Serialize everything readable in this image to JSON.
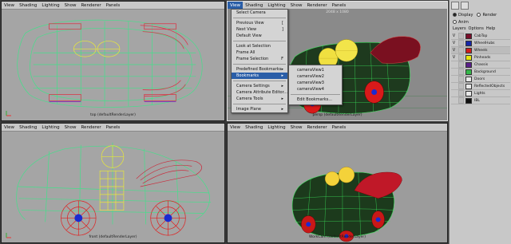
{
  "top_left": {
    "menu": [
      "View",
      "Shading",
      "Lighting",
      "Show",
      "Renderer",
      "Panels"
    ],
    "camera_label": "top (defaultRenderLayer)"
  },
  "top_right": {
    "menu": [
      "View",
      "Shading",
      "Lighting",
      "Show",
      "Renderer",
      "Panels"
    ],
    "resolution_label": "2048 x 1080",
    "camera_label": "persp (defaultRenderLayer)"
  },
  "bottom_left": {
    "menu": [
      "View",
      "Shading",
      "Lighting",
      "Show",
      "Renderer",
      "Panels"
    ],
    "camera_label": "front (defaultRenderLayer)"
  },
  "bottom_right": {
    "menu": [
      "View",
      "Shading",
      "Lighting",
      "Show",
      "Renderer",
      "Panels"
    ],
    "camera_label": "WorkCam (defaultRenderLayer)"
  },
  "view_menu": {
    "items": [
      {
        "label": "Select Camera",
        "key": ""
      },
      {
        "label": "Previous View",
        "key": "["
      },
      {
        "label": "Next View",
        "key": "]"
      },
      {
        "label": "Default View",
        "key": ""
      },
      {
        "label": "Look at Selection",
        "key": ""
      },
      {
        "label": "Frame All",
        "key": ""
      },
      {
        "label": "Frame Selection",
        "key": "F"
      },
      {
        "label": "Predefined Bookmarks",
        "key": "▸"
      },
      {
        "label": "Bookmarks",
        "key": "▸"
      },
      {
        "label": "Camera Settings",
        "key": "▸"
      },
      {
        "label": "Camera Attribute Editor...",
        "key": ""
      },
      {
        "label": "Camera Tools",
        "key": "▸"
      },
      {
        "label": "Image Plane",
        "key": "▸"
      }
    ]
  },
  "bookmarks_menu": {
    "items": [
      "cameraView1",
      "cameraView2",
      "cameraView3",
      "cameraView4",
      "Edit Bookmarks..."
    ]
  },
  "side_panel": {
    "display_label": "Display",
    "render_label": "Render",
    "anim_label": "Anim",
    "tabs": [
      "Layers",
      "Options",
      "Help"
    ],
    "layers": [
      {
        "name": "CabTop",
        "color": "#7a0e2a",
        "visible": "V"
      },
      {
        "name": "WheelHubs",
        "color": "#1626a8",
        "visible": "V"
      },
      {
        "name": "Wheels",
        "color": "#d11a1a",
        "visible": "V"
      },
      {
        "name": "Pinheads",
        "color": "#e6e60e",
        "visible": "V"
      },
      {
        "name": "Chassis",
        "color": "#5a1e8a",
        "visible": ""
      },
      {
        "name": "Background",
        "color": "#35b84a",
        "visible": ""
      },
      {
        "name": "Doors",
        "color": "#e8e8e8",
        "visible": ""
      },
      {
        "name": "ReflectedObjects",
        "color": "#e8e8e8",
        "visible": ""
      },
      {
        "name": "Lights",
        "color": "#e8e8e8",
        "visible": ""
      },
      {
        "name": "IBL",
        "color": "#111111",
        "visible": ""
      }
    ]
  }
}
